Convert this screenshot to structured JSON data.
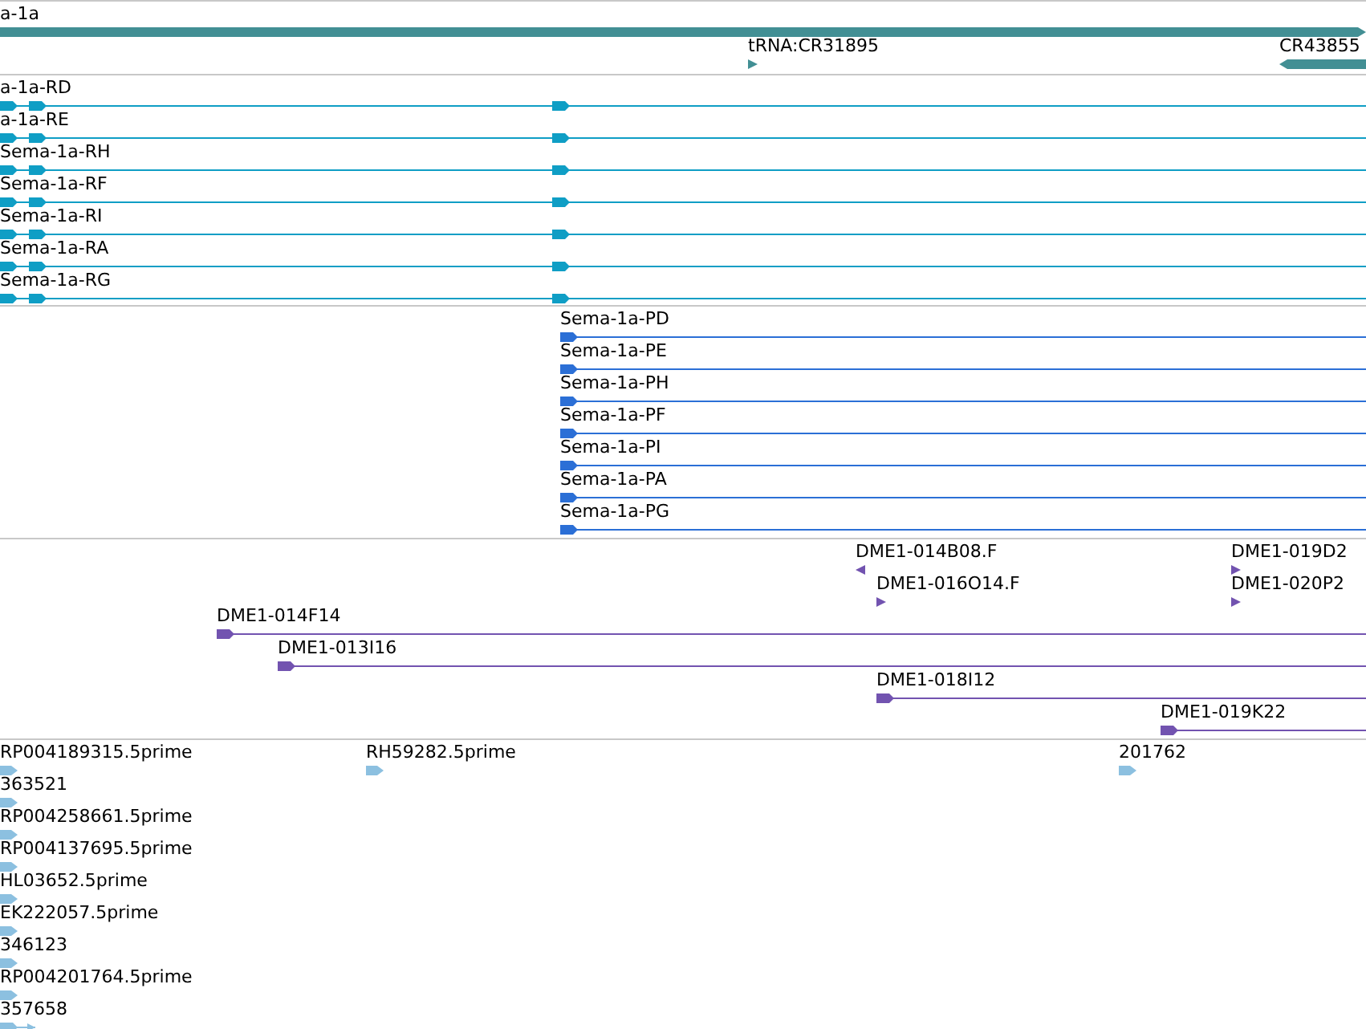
{
  "tracks": [
    {
      "kind": "gene",
      "rows": [
        [
          {
            "label": "a-1a",
            "kind": "bar",
            "reverse": false
          }
        ],
        [
          {
            "label": "tRNA:CR31895",
            "kind": "arrow",
            "reverse": false
          },
          {
            "label": "CR43855",
            "kind": "bar",
            "reverse": true
          }
        ]
      ]
    },
    {
      "kind": "transcript",
      "rows": [
        [
          {
            "label": "a-1a-RD",
            "kind": "line",
            "reverse": false
          }
        ],
        [
          {
            "label": "a-1a-RE",
            "kind": "line",
            "reverse": false
          }
        ],
        [
          {
            "label": "Sema-1a-RH",
            "kind": "line",
            "reverse": false
          }
        ],
        [
          {
            "label": "Sema-1a-RF",
            "kind": "line",
            "reverse": false
          }
        ],
        [
          {
            "label": "Sema-1a-RI",
            "kind": "line",
            "reverse": false
          }
        ],
        [
          {
            "label": "Sema-1a-RA",
            "kind": "line",
            "reverse": false
          }
        ],
        [
          {
            "label": "Sema-1a-RG",
            "kind": "line",
            "reverse": false
          }
        ]
      ]
    },
    {
      "kind": "protein",
      "rows": [
        [
          {
            "label": "Sema-1a-PD",
            "kind": "line",
            "reverse": false
          }
        ],
        [
          {
            "label": "Sema-1a-PE",
            "kind": "line",
            "reverse": false
          }
        ],
        [
          {
            "label": "Sema-1a-PH",
            "kind": "line",
            "reverse": false
          }
        ],
        [
          {
            "label": "Sema-1a-PF",
            "kind": "line",
            "reverse": false
          }
        ],
        [
          {
            "label": "Sema-1a-PI",
            "kind": "line",
            "reverse": false
          }
        ],
        [
          {
            "label": "Sema-1a-PA",
            "kind": "line",
            "reverse": false
          }
        ],
        [
          {
            "label": "Sema-1a-PG",
            "kind": "line",
            "reverse": false
          }
        ]
      ]
    },
    {
      "kind": "clone",
      "rows": [
        [
          {
            "label": "DME1-014B08.F",
            "kind": "arrow",
            "reverse": true
          },
          {
            "label": "DME1-019D2",
            "kind": "arrow",
            "reverse": false
          }
        ],
        [
          {
            "label": "DME1-016O14.F",
            "kind": "arrow",
            "reverse": false
          },
          {
            "label": "DME1-020P2",
            "kind": "arrow",
            "reverse": false
          }
        ],
        [
          {
            "label": "DME1-014F14",
            "kind": "line",
            "reverse": false
          }
        ],
        [
          {
            "label": "DME1-013I16",
            "kind": "line",
            "reverse": false
          }
        ],
        [
          {
            "label": "DME1-018I12",
            "kind": "line",
            "reverse": false
          }
        ],
        [
          {
            "label": "DME1-019K22",
            "kind": "line",
            "reverse": false
          }
        ]
      ]
    },
    {
      "kind": "est",
      "rows": [
        [
          {
            "label": "RP004189315.5prime",
            "kind": "arrow",
            "reverse": false
          },
          {
            "label": "RH59282.5prime",
            "kind": "arrow",
            "reverse": false
          },
          {
            "label": "201762",
            "kind": "arrow",
            "reverse": false
          }
        ],
        [
          {
            "label": "363521",
            "kind": "arrow",
            "reverse": false
          }
        ],
        [
          {
            "label": "RP004258661.5prime",
            "kind": "arrow",
            "reverse": false
          }
        ],
        [
          {
            "label": "RP004137695.5prime",
            "kind": "arrow",
            "reverse": false
          }
        ],
        [
          {
            "label": "HL03652.5prime",
            "kind": "arrow",
            "reverse": false
          }
        ],
        [
          {
            "label": "EK222057.5prime",
            "kind": "arrow",
            "reverse": false
          }
        ],
        [
          {
            "label": "346123",
            "kind": "arrow",
            "reverse": false
          }
        ],
        [
          {
            "label": "RP004201764.5prime",
            "kind": "arrow",
            "reverse": false
          }
        ],
        [
          {
            "label": "357658",
            "kind": "line",
            "reverse": false
          }
        ]
      ]
    }
  ]
}
